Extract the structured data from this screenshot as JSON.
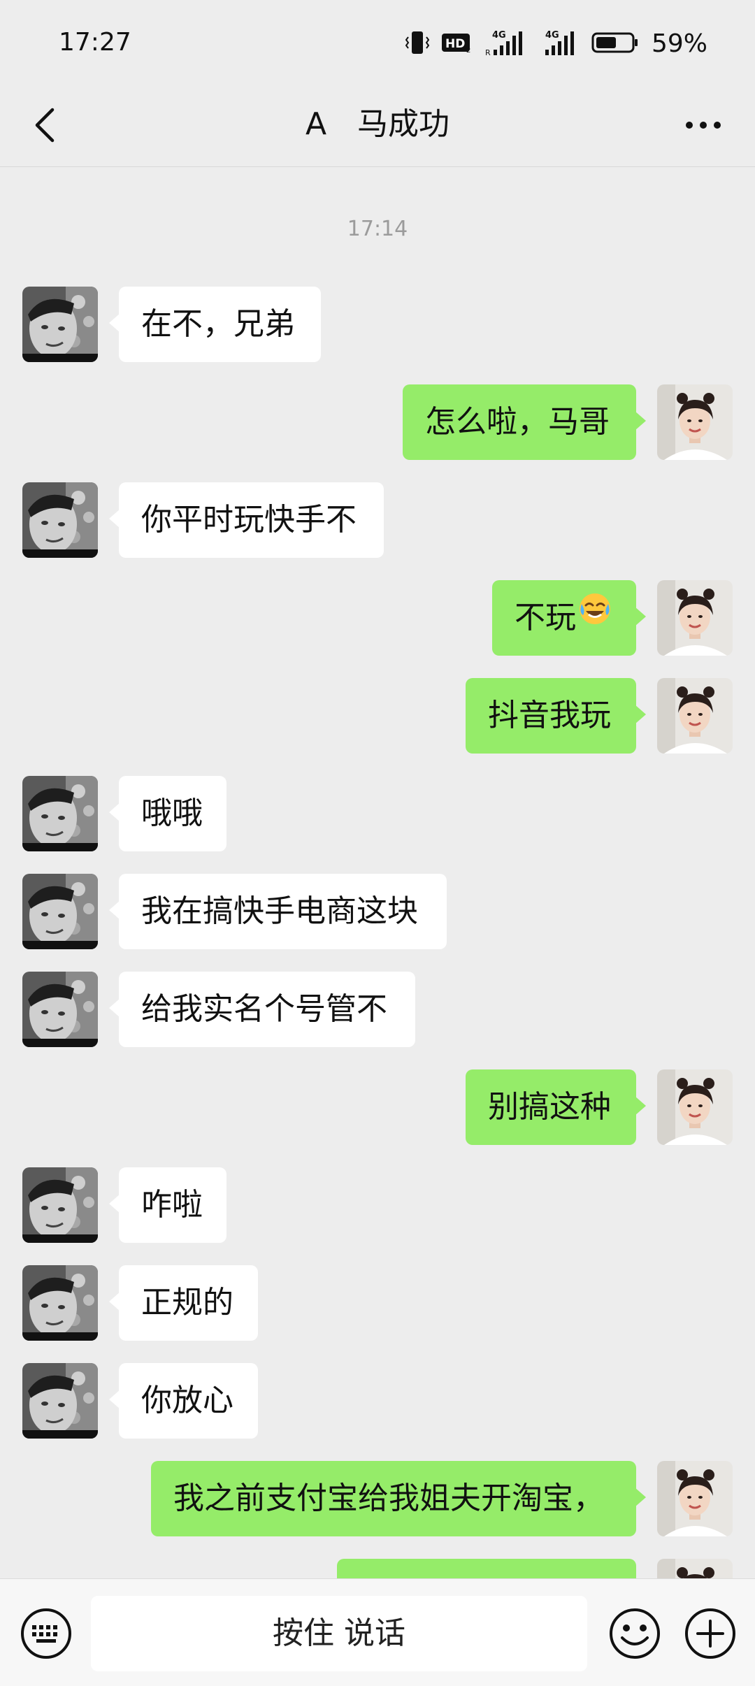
{
  "status_bar": {
    "time": "17:27",
    "battery_percent": "59%",
    "battery_level": 0.59,
    "icons": [
      "vibrate-icon",
      "hd-icon",
      "signal-4g-icon",
      "signal-4g-icon",
      "battery-icon"
    ],
    "hd_label": "HD",
    "net_label": "4G"
  },
  "header": {
    "title": "A　马成功",
    "back_icon": "back-chevron-icon",
    "more_icon": "more-dots-icon"
  },
  "chat": {
    "timestamp": "17:14",
    "messages": [
      {
        "side": "left",
        "text": "在不，兄弟"
      },
      {
        "side": "right",
        "text": "怎么啦，马哥"
      },
      {
        "side": "left",
        "text": "你平时玩快手不"
      },
      {
        "side": "right",
        "text": "不玩",
        "emoji": "laughing-crying-emoji-icon"
      },
      {
        "side": "right",
        "text": "抖音我玩"
      },
      {
        "side": "left",
        "text": "哦哦"
      },
      {
        "side": "left",
        "text": "我在搞快手电商这块"
      },
      {
        "side": "left",
        "text": "给我实名个号管不"
      },
      {
        "side": "right",
        "text": "别搞这种"
      },
      {
        "side": "left",
        "text": "咋啦"
      },
      {
        "side": "left",
        "text": "正规的"
      },
      {
        "side": "left",
        "text": "你放心"
      },
      {
        "side": "right",
        "text": "我之前支付宝给我姐夫开淘宝，"
      },
      {
        "side": "right",
        "text": ""
      }
    ]
  },
  "input_bar": {
    "hold_to_talk_label": "按住 说话",
    "keyboard_icon": "keyboard-icon",
    "emoji_icon": "emoji-icon",
    "plus_icon": "plus-icon"
  },
  "colors": {
    "background": "#ededed",
    "bubble_sent": "#95ec69",
    "bubble_received": "#ffffff"
  }
}
